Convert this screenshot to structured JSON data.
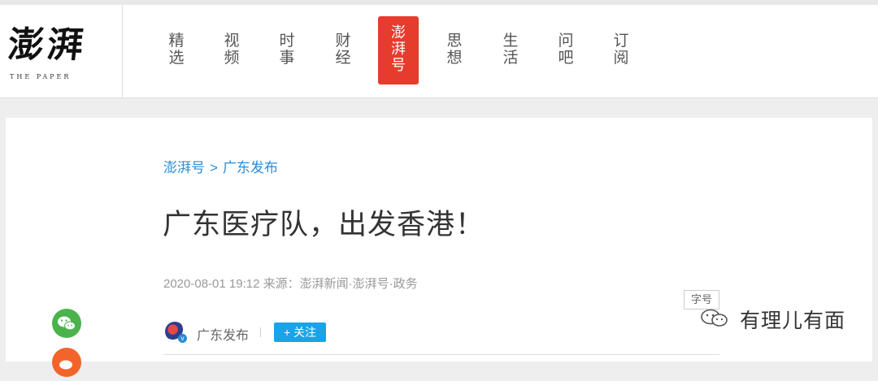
{
  "site": {
    "logo_text": "澎湃",
    "logo_subtitle": "THE PAPER"
  },
  "nav": {
    "items": [
      {
        "label": "精\n选"
      },
      {
        "label": "视\n频"
      },
      {
        "label": "时\n事"
      },
      {
        "label": "财\n经"
      },
      {
        "label": "澎\n湃\n号"
      },
      {
        "label": "思\n想"
      },
      {
        "label": "生\n活"
      },
      {
        "label": "问\n吧"
      },
      {
        "label": "订\n阅"
      }
    ],
    "active_index": 4
  },
  "article": {
    "breadcrumb": [
      "澎湃号",
      "广东发布"
    ],
    "breadcrumb_separator": ">",
    "title": "广东医疗队，出发香港！",
    "meta": "2020-08-01 19:12 来源：澎湃新闻·澎湃号·政务",
    "font_size_label": "字号",
    "author": {
      "name": "广东发布",
      "verified_badge": "v",
      "follow_label": "+ 关注"
    }
  },
  "share": {
    "icons": [
      "wechat-icon",
      "weibo-icon"
    ]
  },
  "watermark": {
    "text": "有理儿有面"
  },
  "colors": {
    "accent_red": "#e63c2d",
    "link_blue": "#2a8bd6",
    "follow_blue": "#19a3e8",
    "wechat_green": "#4ab34c"
  }
}
